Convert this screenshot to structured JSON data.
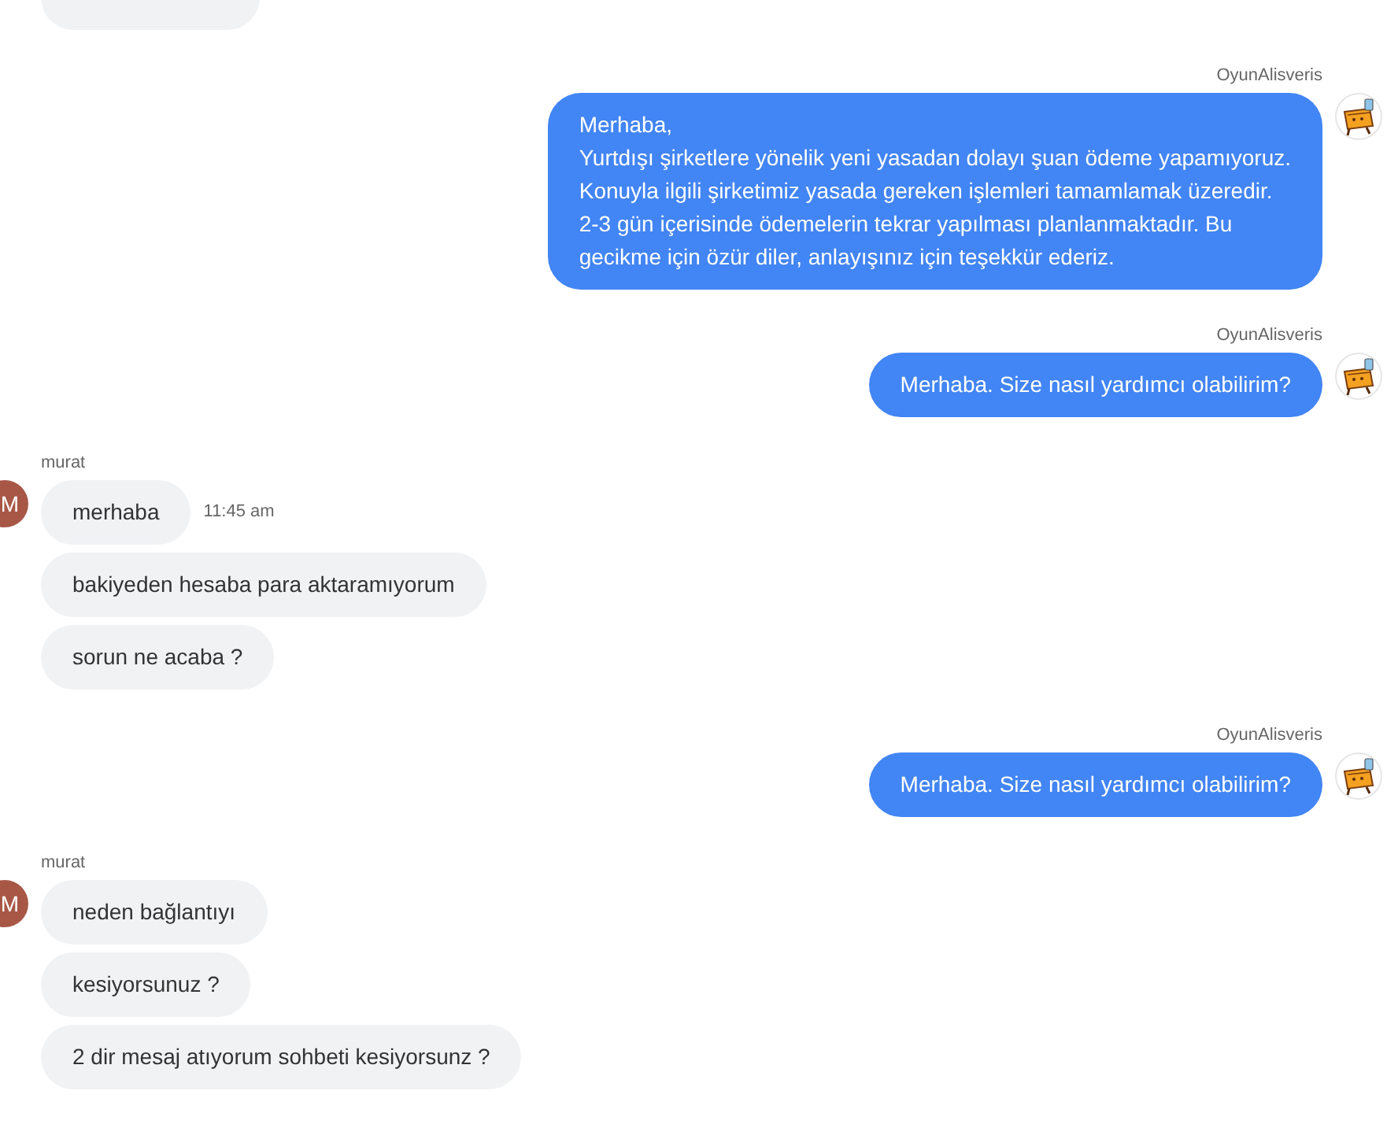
{
  "conversation": [
    {
      "kind": "incoming",
      "messages": [
        {
          "cut": true
        }
      ]
    },
    {
      "kind": "outgoing",
      "sender": "OyunAlisveris",
      "messages": [
        {
          "text": "Merhaba,\nYurtdışı şirketlere yönelik yeni yasadan dolayı şuan ödeme yapamıyoruz.\nKonuyla ilgili şirketimiz yasada gereken işlemleri tamamlamak üzeredir.\n2-3 gün içerisinde ödemelerin tekrar yapılması planlanmaktadır. Bu\ngecikme için özür diler, anlayışınız için teşekkür ederiz."
        }
      ]
    },
    {
      "kind": "outgoing",
      "sender": "OyunAlisveris",
      "messages": [
        {
          "text": "Merhaba. Size nasıl yardımcı olabilirim?"
        }
      ]
    },
    {
      "kind": "incoming",
      "sender": "murat",
      "avatar": "M",
      "messages": [
        {
          "text": "merhaba",
          "time": "11:45 am"
        },
        {
          "text": "bakiyeden hesaba para aktaramıyorum"
        },
        {
          "text": "sorun ne acaba ?"
        }
      ]
    },
    {
      "kind": "outgoing",
      "sender": "OyunAlisveris",
      "messages": [
        {
          "text": "Merhaba. Size nasıl yardımcı olabilirim?"
        }
      ]
    },
    {
      "kind": "incoming",
      "sender": "murat",
      "avatar": "M",
      "messages": [
        {
          "text": "neden bağlantıyı"
        },
        {
          "text": "kesiyorsunuz ?"
        },
        {
          "text": "2 dir mesaj atıyorum sohbeti kesiyorsunz ?"
        }
      ]
    }
  ]
}
